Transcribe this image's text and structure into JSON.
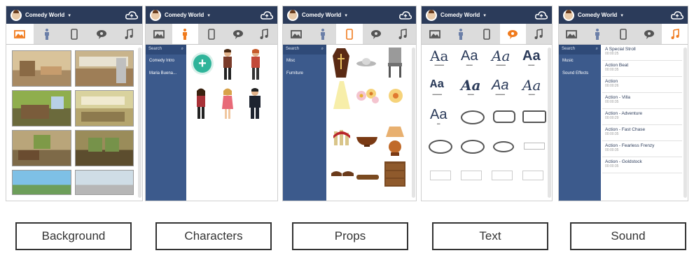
{
  "workspace_name": "Comedy World",
  "panel_labels": [
    "Background",
    "Characters",
    "Props",
    "Text",
    "Sound"
  ],
  "characters_nav": {
    "header": "Search",
    "items": [
      "Comedy Intro",
      "Maria Buena..."
    ]
  },
  "props_nav": {
    "header": "Search",
    "items": [
      "Misc",
      "Furniture"
    ]
  },
  "text_tiles": [
    "Aa",
    "Aa",
    "Aa",
    "Aa",
    "Aa",
    "Aa",
    "Aa",
    "Aa",
    "Aa"
  ],
  "sound_nav": {
    "header": "Search",
    "items": [
      "Music",
      "Sound Effects"
    ]
  },
  "sounds": [
    {
      "name": "A Special Stroll",
      "duration": "00:00:25"
    },
    {
      "name": "Action Beat",
      "duration": "00:00:35"
    },
    {
      "name": "Action",
      "duration": "00:00:26"
    },
    {
      "name": "Action - Villa",
      "duration": "00:00:35"
    },
    {
      "name": "Action - Adventure",
      "duration": "00:00:29"
    },
    {
      "name": "Action - Fast Chase",
      "duration": "00:00:35"
    },
    {
      "name": "Action - Fearless Frenzy",
      "duration": "00:00:35"
    },
    {
      "name": "Action - Goldstock",
      "duration": "00:00:35"
    }
  ],
  "colors": {
    "topbar": "#2b3b5a",
    "sidenav": "#3c5a8c",
    "accent": "#f07b1e",
    "add": "#2fb49a"
  },
  "tab_icons": [
    "background-icon",
    "character-icon",
    "prop-icon",
    "text-bubble-icon",
    "music-note-icon"
  ]
}
